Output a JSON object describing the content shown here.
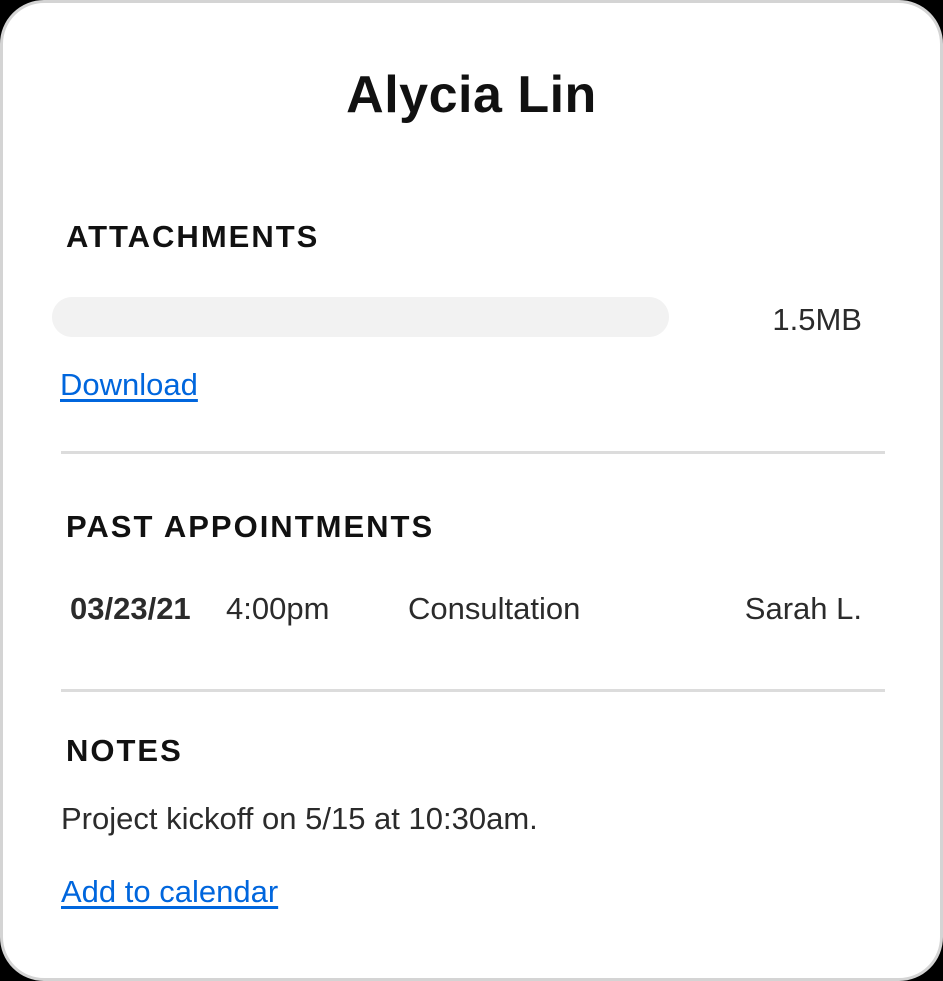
{
  "client": {
    "name": "Alycia Lin"
  },
  "attachments": {
    "heading": "ATTACHMENTS",
    "file": {
      "size": "1.5MB",
      "bar_color": "#f2f2f2"
    },
    "download_label": "Download"
  },
  "past_appointments": {
    "heading": "PAST APPOINTMENTS",
    "rows": [
      {
        "date": "03/23/21",
        "time": "4:00pm",
        "type": "Consultation",
        "staff": "Sarah L."
      }
    ]
  },
  "notes": {
    "heading": "NOTES",
    "text": "Project kickoff on 5/15 at 10:30am.",
    "add_to_calendar_label": "Add to calendar"
  },
  "colors": {
    "link": "#0066dd",
    "divider": "#dcdcdc",
    "card_border": "#d4d4d4"
  }
}
